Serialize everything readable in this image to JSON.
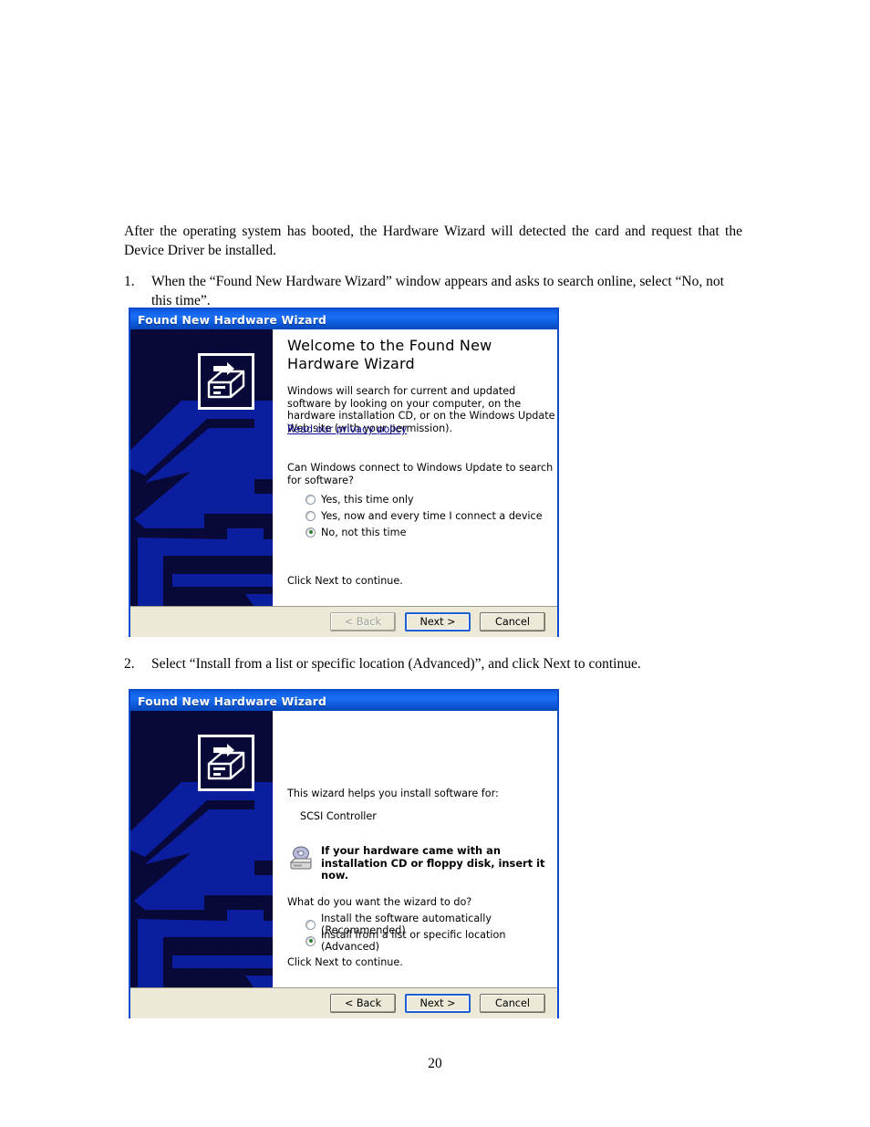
{
  "document": {
    "intro": "After the operating system has booted, the Hardware Wizard will detected the card and request that the Device Driver be installed.",
    "steps": [
      {
        "number": "1.",
        "text": "When the “Found New Hardware Wizard” window appears and asks to search online, select “No, not this time”."
      },
      {
        "number": "2.",
        "text": "Select “Install from a list or specific location (Advanced)”, and click Next to continue."
      }
    ],
    "page_number": "20"
  },
  "wizard1": {
    "title": "Found New Hardware Wizard",
    "heading": "Welcome to the Found New Hardware Wizard",
    "paragraph": "Windows will search for current and updated software by looking on your computer, on the hardware installation CD, or on the Windows Update Web site (with your permission).",
    "privacy_link": "Read our privacy policy",
    "question": "Can Windows connect to Windows Update to search for software?",
    "options": [
      {
        "label": "Yes, this time only",
        "checked": false
      },
      {
        "label": "Yes, now and every time I connect a device",
        "checked": false
      },
      {
        "label": "No, not this time",
        "checked": true
      }
    ],
    "footer_note": "Click Next to continue.",
    "buttons": {
      "back": "< Back",
      "next": "Next >",
      "cancel": "Cancel"
    }
  },
  "wizard2": {
    "title": "Found New Hardware Wizard",
    "intro": "This wizard helps you install software for:",
    "device": "SCSI Controller",
    "cd_notice": "If your hardware came with an installation CD or floppy disk, insert it now.",
    "question": "What do you want the wizard to do?",
    "options": [
      {
        "label": "Install the software automatically (Recommended)",
        "checked": false
      },
      {
        "label": "Install from a list or specific location (Advanced)",
        "checked": true
      }
    ],
    "footer_note": "Click Next to continue.",
    "buttons": {
      "back": "< Back",
      "next": "Next >",
      "cancel": "Cancel"
    }
  },
  "colors": {
    "titlebar_blue": "#0B57D8",
    "window_border": "#0A4BD0",
    "banner_dark": "#08083a",
    "banner_accent": "#0b1ea0",
    "footer_beige": "#ECE9D8",
    "link_blue": "#10109a",
    "radio_dot_green": "#2e7d32"
  }
}
